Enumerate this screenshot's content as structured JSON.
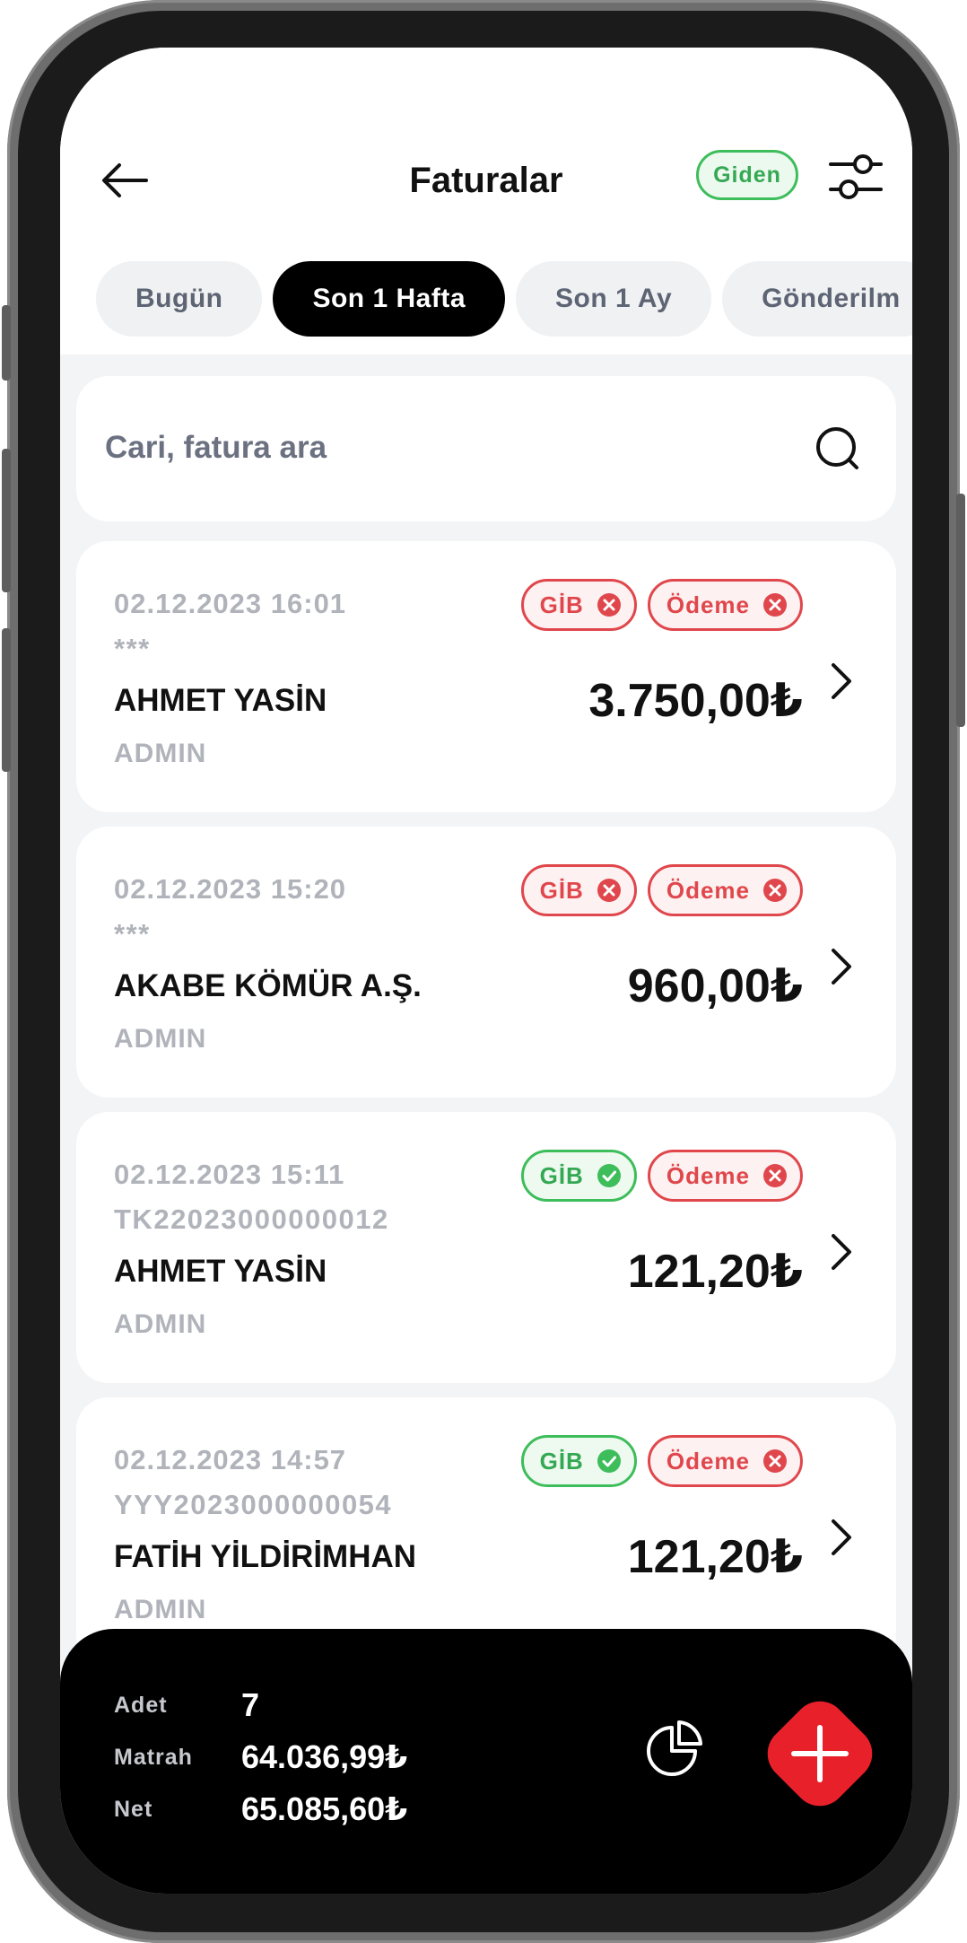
{
  "header": {
    "title": "Faturalar",
    "direction_badge": "Giden"
  },
  "tabs": [
    {
      "label": "Bugün",
      "active": false
    },
    {
      "label": "Son 1 Hafta",
      "active": true
    },
    {
      "label": "Son 1 Ay",
      "active": false
    },
    {
      "label": "Gönderilm",
      "active": false
    }
  ],
  "search": {
    "placeholder": "Cari, fatura ara"
  },
  "invoices": [
    {
      "date": "02.12.2023 16:01",
      "doc_no": "***",
      "name": "AHMET YASİN",
      "user": "ADMIN",
      "amount": "3.750,00₺",
      "gib": {
        "label": "GİB",
        "status": "error"
      },
      "payment": {
        "label": "Ödeme",
        "status": "error"
      }
    },
    {
      "date": "02.12.2023 15:20",
      "doc_no": "***",
      "name": "AKABE KÖMÜR A.Ş.",
      "user": "ADMIN",
      "amount": "960,00₺",
      "gib": {
        "label": "GİB",
        "status": "error"
      },
      "payment": {
        "label": "Ödeme",
        "status": "error"
      }
    },
    {
      "date": "02.12.2023 15:11",
      "doc_no": "TK22023000000012",
      "name": "AHMET YASİN",
      "user": "ADMIN",
      "amount": "121,20₺",
      "gib": {
        "label": "GİB",
        "status": "ok"
      },
      "payment": {
        "label": "Ödeme",
        "status": "error"
      }
    },
    {
      "date": "02.12.2023 14:57",
      "doc_no": "YYY2023000000054",
      "name": "FATİH YİLDİRİMHAN",
      "user": "ADMIN",
      "amount": "121,20₺",
      "gib": {
        "label": "GİB",
        "status": "ok"
      },
      "payment": {
        "label": "Ödeme",
        "status": "error"
      }
    }
  ],
  "summary": {
    "count_label": "Adet",
    "count_value": "7",
    "base_label": "Matrah",
    "base_value": "64.036,99₺",
    "net_label": "Net",
    "net_value": "65.085,60₺"
  },
  "icons": {
    "back": "arrow-left-icon",
    "filter": "sliders-icon",
    "search": "search-icon",
    "chevron": "chevron-right-icon",
    "status_error": "x-circle-icon",
    "status_ok": "check-circle-icon",
    "chart": "pie-chart-icon",
    "add": "plus-icon"
  },
  "colors": {
    "accent_red": "#e8202a",
    "error": "#e0474c",
    "success": "#34a853",
    "dark": "#000000"
  }
}
